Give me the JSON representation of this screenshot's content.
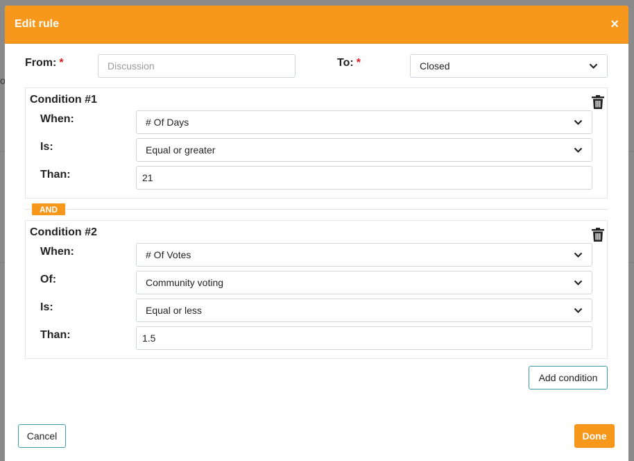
{
  "backdrop": {
    "edge_char": "o"
  },
  "modal": {
    "title": "Edit rule",
    "close_symbol": "×"
  },
  "rule": {
    "from_label": "From:",
    "from_placeholder": "Discussion",
    "to_label": "To:",
    "to_value": "Closed",
    "required_marker": "*"
  },
  "conditions": [
    {
      "title": "Condition #1",
      "rows": [
        {
          "label": "When:",
          "type": "select",
          "value": "# Of Days"
        },
        {
          "label": "Is:",
          "type": "select",
          "value": "Equal or greater"
        },
        {
          "label": "Than:",
          "type": "input",
          "value": "21"
        }
      ]
    },
    {
      "title": "Condition #2",
      "rows": [
        {
          "label": "When:",
          "type": "select",
          "value": "# Of Votes"
        },
        {
          "label": "Of:",
          "type": "select",
          "value": "Community voting"
        },
        {
          "label": "Is:",
          "type": "select",
          "value": "Equal or less"
        },
        {
          "label": "Than:",
          "type": "input",
          "value": "1.5"
        }
      ]
    }
  ],
  "and_label": "AND",
  "buttons": {
    "add_condition": "Add condition",
    "cancel": "Cancel",
    "done": "Done"
  },
  "colors": {
    "accent": "#f7981d",
    "outline_button": "#3a9aa8",
    "required": "#e0161e"
  },
  "icons": [
    "close-icon",
    "chevron-down-icon",
    "trash-icon"
  ]
}
